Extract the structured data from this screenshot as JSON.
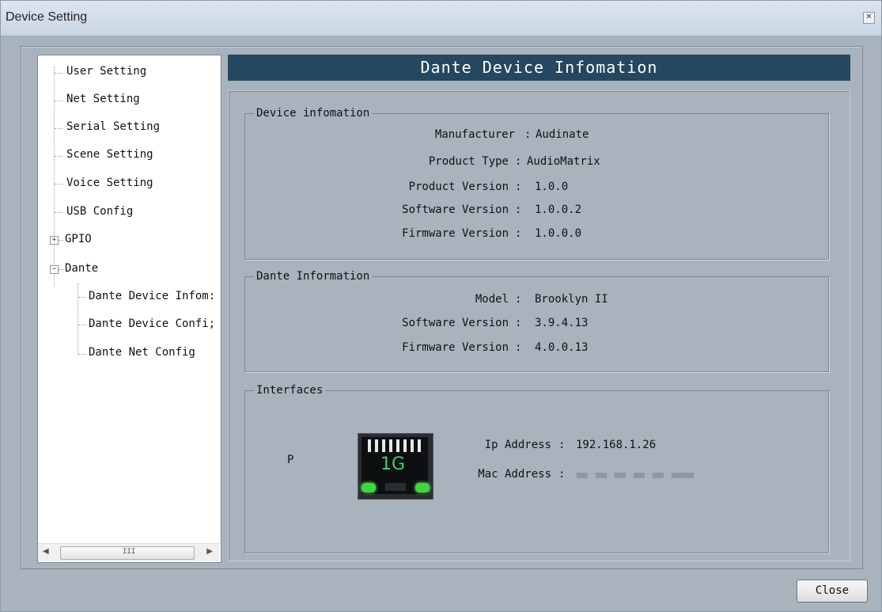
{
  "window": {
    "title": "Device Setting",
    "close_glyph": "✕"
  },
  "tree": {
    "items": [
      {
        "label": "User Setting"
      },
      {
        "label": "Net Setting"
      },
      {
        "label": "Serial Setting"
      },
      {
        "label": "Scene Setting"
      },
      {
        "label": "Voice Setting"
      },
      {
        "label": "USB Config"
      },
      {
        "label": "GPIO",
        "expander": "+"
      },
      {
        "label": "Dante",
        "expander": "−"
      },
      {
        "label": "Dante Device Infom:"
      },
      {
        "label": "Dante Device Confi;"
      },
      {
        "label": "Dante Net Config"
      }
    ],
    "scroll_left": "◀",
    "scroll_right": "▶",
    "scroll_grip": "III"
  },
  "panel": {
    "header": "Dante Device Infomation",
    "device_info": {
      "legend": "Device infomation",
      "rows": [
        {
          "label": "Manufacturer",
          "value": "Audinate"
        },
        {
          "label": "Product Type",
          "value": "AudioMatrix"
        },
        {
          "label": "Product Version",
          "value": "1.0.0"
        },
        {
          "label": "Software Version",
          "value": "1.0.0.2"
        },
        {
          "label": "Firmware Version",
          "value": "1.0.0.0"
        }
      ]
    },
    "dante_info": {
      "legend": "Dante Information",
      "rows": [
        {
          "label": "Model",
          "value": "Brooklyn II"
        },
        {
          "label": "Software Version",
          "value": "3.9.4.13"
        },
        {
          "label": "Firmware Version",
          "value": "4.0.0.13"
        }
      ]
    },
    "interfaces": {
      "legend": "Interfaces",
      "port_label": "P",
      "link_speed": "1G",
      "ip_label": "Ip Address",
      "ip_value": "192.168.1.26",
      "mac_label": "Mac Address"
    },
    "colon": ":"
  },
  "footer": {
    "close_label": "Close"
  }
}
